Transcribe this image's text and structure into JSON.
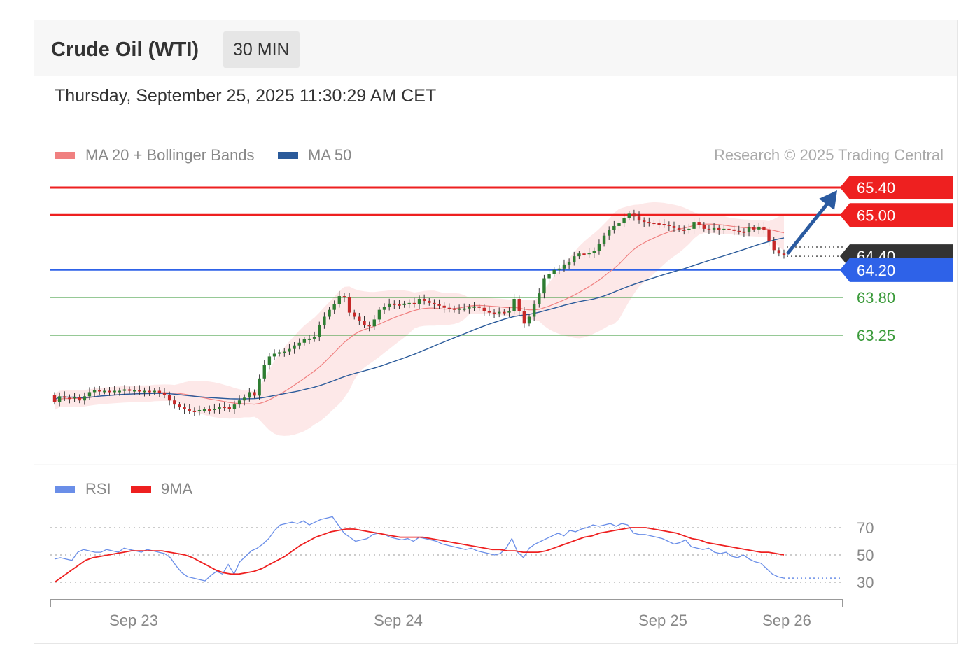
{
  "header": {
    "title": "Crude Oil (WTI)",
    "interval_badge": "30 MIN",
    "timestamp": "Thursday, September 25, 2025 11:30:29 AM CET"
  },
  "legend": {
    "ma20_label": "MA 20 + Bollinger Bands",
    "ma50_label": "MA 50",
    "copyright": "Research © 2025 Trading Central",
    "rsi_label": "RSI",
    "rsi_ma_label": "9MA"
  },
  "colors": {
    "resistance": "#ee2020",
    "pivot": "#2e62e8",
    "support": "#3a9a3a",
    "ma20": "#f08080",
    "bollinger_fill": "#fde4e4",
    "ma50": "#2a5a9a",
    "up_candle": "#2e7d32",
    "down_candle": "#c62828",
    "arrow": "#2a5aa0",
    "current_price_tag": "#333333",
    "rsi": "#6a8ee8",
    "rsi_ma": "#ee2020"
  },
  "chart_data": [
    {
      "type": "candlestick",
      "title": "Crude Oil (WTI)",
      "interval": "30 MIN",
      "x_ticks": [
        "Sep 23",
        "Sep 24",
        "Sep 25",
        "Sep 26"
      ],
      "ylim": [
        62.2,
        65.6
      ],
      "levels": [
        {
          "label": "65.40",
          "value": 65.4,
          "kind": "resistance"
        },
        {
          "label": "65.00",
          "value": 65.0,
          "kind": "resistance"
        },
        {
          "label": "64.40",
          "value": 64.4,
          "kind": "current"
        },
        {
          "label": "64.20",
          "value": 64.2,
          "kind": "pivot"
        },
        {
          "label": "63.80",
          "value": 63.8,
          "kind": "support"
        },
        {
          "label": "63.25",
          "value": 63.25,
          "kind": "support"
        }
      ],
      "series": [
        {
          "name": "MA 20 + Bollinger Bands",
          "kind": "bollinger"
        },
        {
          "name": "MA 50",
          "kind": "moving_average"
        }
      ],
      "close": [
        62.28,
        62.36,
        62.34,
        62.33,
        62.35,
        62.3,
        62.36,
        62.42,
        62.45,
        62.43,
        62.44,
        62.43,
        62.44,
        62.44,
        62.46,
        62.44,
        62.45,
        62.43,
        62.44,
        62.42,
        62.44,
        62.41,
        62.38,
        62.3,
        62.24,
        62.2,
        62.17,
        62.15,
        62.14,
        62.16,
        62.17,
        62.16,
        62.18,
        62.21,
        62.2,
        62.17,
        62.24,
        62.3,
        62.34,
        62.42,
        62.37,
        62.62,
        62.82,
        62.94,
        62.98,
        63.0,
        63.01,
        63.05,
        63.1,
        63.14,
        63.19,
        63.2,
        63.23,
        63.4,
        63.52,
        63.62,
        63.7,
        63.82,
        63.8,
        63.58,
        63.52,
        63.46,
        63.4,
        63.38,
        63.48,
        63.62,
        63.66,
        63.71,
        63.7,
        63.69,
        63.71,
        63.72,
        63.7,
        63.78,
        63.75,
        63.72,
        63.7,
        63.68,
        63.65,
        63.64,
        63.62,
        63.64,
        63.64,
        63.66,
        63.67,
        63.65,
        63.6,
        63.58,
        63.57,
        63.59,
        63.58,
        63.6,
        63.78,
        63.6,
        63.42,
        63.52,
        63.7,
        63.86,
        64.08,
        64.14,
        64.2,
        64.22,
        64.28,
        64.32,
        64.4,
        64.44,
        64.43,
        64.45,
        64.48,
        64.58,
        64.7,
        64.78,
        64.84,
        64.88,
        64.96,
        65.02,
        64.98,
        64.92,
        64.9,
        64.89,
        64.88,
        64.87,
        64.86,
        64.84,
        64.81,
        64.79,
        64.78,
        64.8,
        64.9,
        64.86,
        64.8,
        64.79,
        64.81,
        64.78,
        64.8,
        64.79,
        64.77,
        64.76,
        64.75,
        64.82,
        64.79,
        64.83,
        64.78,
        64.62,
        64.49,
        64.44,
        64.43
      ]
    },
    {
      "type": "line",
      "title": "RSI",
      "x_ticks": [
        "Sep 23",
        "Sep 24",
        "Sep 25",
        "Sep 26"
      ],
      "y_ticks": [
        70,
        50,
        30
      ],
      "ylim": [
        25,
        80
      ],
      "series": [
        {
          "name": "RSI",
          "values": [
            47,
            48,
            47,
            46,
            52,
            54,
            53,
            52,
            52,
            54,
            53,
            52,
            55,
            54,
            53,
            52,
            54,
            53,
            52,
            51,
            48,
            42,
            37,
            34,
            33,
            32,
            31,
            35,
            38,
            36,
            43,
            36,
            45,
            49,
            53,
            55,
            58,
            62,
            68,
            72,
            73,
            74,
            73,
            75,
            72,
            74,
            76,
            77,
            78,
            72,
            66,
            63,
            60,
            61,
            62,
            65,
            66,
            65,
            63,
            62,
            61,
            62,
            60,
            63,
            62,
            61,
            60,
            58,
            57,
            56,
            55,
            54,
            55,
            53,
            52,
            51,
            50,
            51,
            55,
            62,
            52,
            48,
            55,
            58,
            60,
            62,
            64,
            66,
            64,
            68,
            67,
            69,
            70,
            72,
            71,
            72,
            73,
            71,
            73,
            72,
            66,
            65,
            65,
            64,
            63,
            62,
            60,
            58,
            59,
            61,
            56,
            55,
            54,
            55,
            52,
            51,
            52,
            49,
            48,
            50,
            47,
            45,
            44,
            40,
            36,
            34,
            33
          ]
        },
        {
          "name": "9MA",
          "values": [
            30,
            34,
            38,
            42,
            46,
            48,
            49,
            50,
            51,
            52,
            53,
            53,
            53,
            53,
            53,
            52,
            51,
            50,
            48,
            45,
            42,
            39,
            37,
            36,
            36,
            37,
            38,
            40,
            43,
            46,
            49,
            53,
            57,
            60,
            63,
            65,
            67,
            68,
            69,
            69,
            68,
            67,
            66,
            65,
            64,
            63,
            63,
            63,
            63,
            62,
            61,
            60,
            59,
            58,
            57,
            56,
            55,
            54,
            54,
            53,
            53,
            52,
            52,
            52,
            53,
            55,
            57,
            59,
            61,
            63,
            64,
            66,
            67,
            68,
            69,
            70,
            70,
            70,
            69,
            68,
            67,
            66,
            64,
            62,
            61,
            59,
            58,
            57,
            56,
            55,
            54,
            53,
            52,
            52,
            51,
            50
          ]
        }
      ]
    }
  ]
}
